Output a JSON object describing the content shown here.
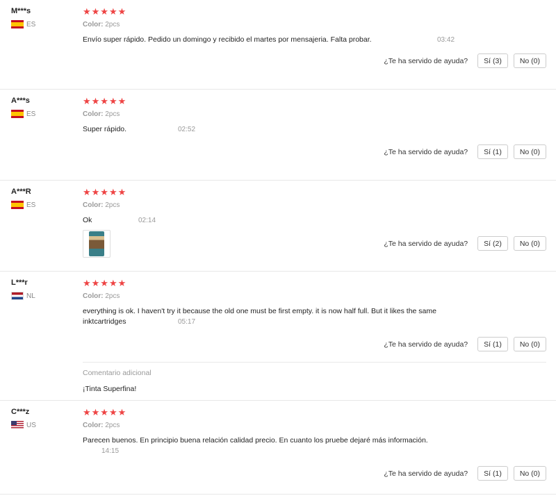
{
  "helpful_question": "¿Te ha servido de ayuda?",
  "stars": "★★★★★",
  "reviews": [
    {
      "user": "M***s",
      "country": "ES",
      "flag": "es",
      "color_label": "Color:",
      "color_value": "2pcs",
      "text": "Envío super rápido. Pedido un domingo y recibido el martes por mensajeria. Falta probar.",
      "time": "03:42",
      "yes": "Sí (3)",
      "no": "No (0)"
    },
    {
      "user": "A***s",
      "country": "ES",
      "flag": "es",
      "color_label": "Color:",
      "color_value": "2pcs",
      "text": "Super rápido.",
      "time": "02:52",
      "yes": "Sí (1)",
      "no": "No (0)"
    },
    {
      "user": "A***R",
      "country": "ES",
      "flag": "es",
      "color_label": "Color:",
      "color_value": "2pcs",
      "text": "Ok",
      "time": "02:14",
      "yes": "Sí (2)",
      "no": "No (0)"
    },
    {
      "user": "L***r",
      "country": "NL",
      "flag": "nl",
      "color_label": "Color:",
      "color_value": "2pcs",
      "text": "everything is ok. I haven't try it because the old one must be first empty. it is now half full. But it likes the same inktcartridges",
      "time": "05:17",
      "yes": "Sí (1)",
      "no": "No (0)",
      "additional_label": "Comentario adicional",
      "additional_text": "¡Tinta Superfina!"
    },
    {
      "user": "C***z",
      "country": "US",
      "flag": "us",
      "color_label": "Color:",
      "color_value": "2pcs",
      "text": "Parecen buenos. En principio buena relación calidad precio. En cuanto los pruebe dejaré más información.",
      "time": "14:15",
      "yes": "Sí (1)",
      "no": "No (0)"
    }
  ]
}
